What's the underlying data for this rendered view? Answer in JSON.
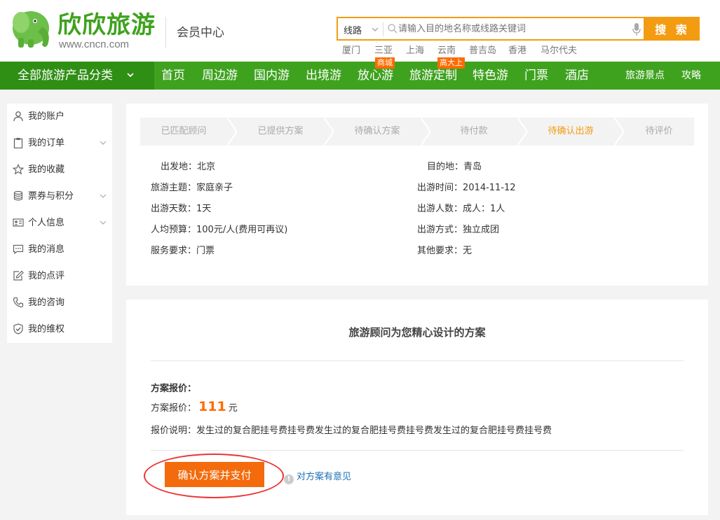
{
  "header": {
    "logo_text": "欣欣旅游",
    "logo_url": "www.cncn.com",
    "member_center": "会员中心",
    "search": {
      "type": "线路",
      "placeholder": "请输入目的地名称或线路关键词",
      "button": "搜 索"
    },
    "hot_links": [
      "厦门",
      "三亚",
      "上海",
      "云南",
      "普吉岛",
      "香港",
      "马尔代夫"
    ]
  },
  "nav": {
    "all_products": "全部旅游产品分类",
    "items": [
      "首页",
      "周边游",
      "国内游",
      "出境游",
      "放心游",
      "旅游定制",
      "特色游",
      "门票",
      "酒店"
    ],
    "right_items": [
      "旅游景点",
      "攻略"
    ],
    "badges": {
      "mall": "商城",
      "premium": "高大上"
    }
  },
  "sidebar": {
    "items": [
      {
        "label": "我的账户",
        "icon": "user-icon"
      },
      {
        "label": "我的订单",
        "icon": "clipboard-icon"
      },
      {
        "label": "我的收藏",
        "icon": "star-icon"
      },
      {
        "label": "票券与积分",
        "icon": "coins-icon"
      },
      {
        "label": "个人信息",
        "icon": "id-card-icon"
      },
      {
        "label": "我的消息",
        "icon": "message-icon"
      },
      {
        "label": "我的点评",
        "icon": "edit-icon"
      },
      {
        "label": "我的咨询",
        "icon": "phone-icon"
      },
      {
        "label": "我的维权",
        "icon": "shield-icon"
      }
    ]
  },
  "steps": [
    "已匹配顾问",
    "已提供方案",
    "待确认方案",
    "待付款",
    "待确认出游",
    "待评价"
  ],
  "active_step": "待确认出游",
  "info": {
    "departure_label": "出发地：",
    "departure": "北京",
    "destination_label": "目的地：",
    "destination": "青岛",
    "theme_label": "旅游主题：",
    "theme": "家庭亲子",
    "date_label": "出游时间：",
    "date": "2014-11-12",
    "days_label": "出游天数：",
    "days": "1天",
    "people_label": "出游人数：",
    "people": "成人：1人",
    "budget_label": "人均预算：",
    "budget": "100元/人(费用可再议)",
    "mode_label": "出游方式：",
    "mode": "独立成团",
    "service_label": "服务要求：",
    "service": "门票",
    "other_label": "其他要求：",
    "other": "无"
  },
  "plan": {
    "title": "旅游顾问为您精心设计的方案",
    "quote_heading": "方案报价：",
    "quote_label": "方案报价：",
    "quote_price": "111",
    "quote_unit": "元",
    "desc_label": "报价说明：",
    "desc": "发生过的复合肥挂号费挂号费发生过的复合肥挂号费挂号费发生过的复合肥挂号费挂号费",
    "confirm_button": "确认方案并支付",
    "feedback_link": "对方案有意见"
  },
  "colors": {
    "brand_green": "#3fa21f",
    "accent_orange": "#f39c12",
    "button_orange": "#f36b0c",
    "link_blue": "#1a6fb6"
  }
}
